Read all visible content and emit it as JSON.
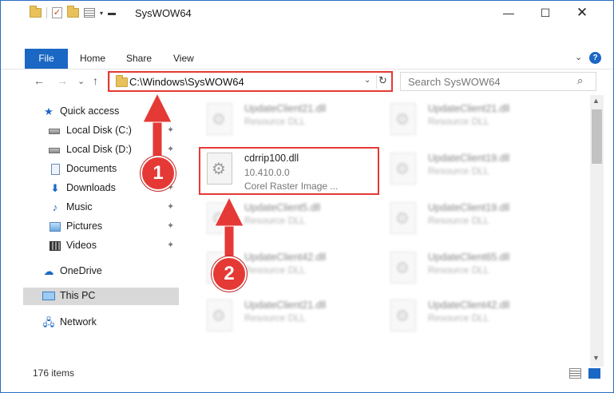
{
  "window": {
    "title": "SysWOW64",
    "controls": {
      "minimize": "—",
      "maximize": "☐",
      "close": "✕"
    }
  },
  "ribbon": {
    "tabs": [
      "File",
      "Home",
      "Share",
      "View"
    ],
    "expand_glyph": "⌄",
    "help_glyph": "?"
  },
  "nav": {
    "back": "←",
    "forward": "→",
    "recent": "⌄",
    "up": "↑",
    "address_path": "C:\\Windows\\SysWOW64",
    "address_dropdown": "⌄",
    "refresh": "↻",
    "search_placeholder": "Search SysWOW64",
    "search_icon": "⌕"
  },
  "sidebar": {
    "items": [
      {
        "label": "Quick access",
        "icon": "star-icon",
        "pinned": false
      },
      {
        "label": "Local Disk (C:)",
        "icon": "drive-icon",
        "pinned": true
      },
      {
        "label": "Local Disk (D:)",
        "icon": "drive-icon",
        "pinned": true
      },
      {
        "label": "Documents",
        "icon": "documents-icon",
        "pinned": true
      },
      {
        "label": "Downloads",
        "icon": "download-icon",
        "pinned": true
      },
      {
        "label": "Music",
        "icon": "music-icon",
        "pinned": true
      },
      {
        "label": "Pictures",
        "icon": "pictures-icon",
        "pinned": true
      },
      {
        "label": "Videos",
        "icon": "videos-icon",
        "pinned": true
      },
      {
        "label": "OneDrive",
        "icon": "cloud-icon",
        "pinned": false
      },
      {
        "label": "This PC",
        "icon": "computer-icon",
        "pinned": false,
        "selected": true
      },
      {
        "label": "Network",
        "icon": "network-icon",
        "pinned": false
      }
    ],
    "pin_glyph": "📌"
  },
  "files": {
    "highlighted": {
      "name": "cdrrip100.dll",
      "version": "10.410.0.0",
      "description": "Corel Raster Image ..."
    },
    "blurred": [
      {
        "name": "UpdateClient21.dll",
        "type": "Resource DLL"
      },
      {
        "name": "UpdateClient21.dll",
        "type": "Resource DLL"
      },
      {
        "name": "UpdateClient19.dll",
        "type": "Resource DLL"
      },
      {
        "name": "UpdateClient5.dll",
        "type": "Resource DLL"
      },
      {
        "name": "UpdateClient19.dll",
        "type": "Resource DLL"
      },
      {
        "name": "UpdateClient42.dll",
        "type": "Resource DLL"
      },
      {
        "name": "UpdateClient65.dll",
        "type": "Resource DLL"
      },
      {
        "name": "UpdateClient21.dll",
        "type": "Resource DLL"
      },
      {
        "name": "UpdateClient42.dll",
        "type": "Resource DLL"
      }
    ],
    "gear_glyph": "⚙"
  },
  "status": {
    "item_count": "176 items"
  },
  "annotations": {
    "step1": "1",
    "step2": "2",
    "accent": "#e53935"
  }
}
